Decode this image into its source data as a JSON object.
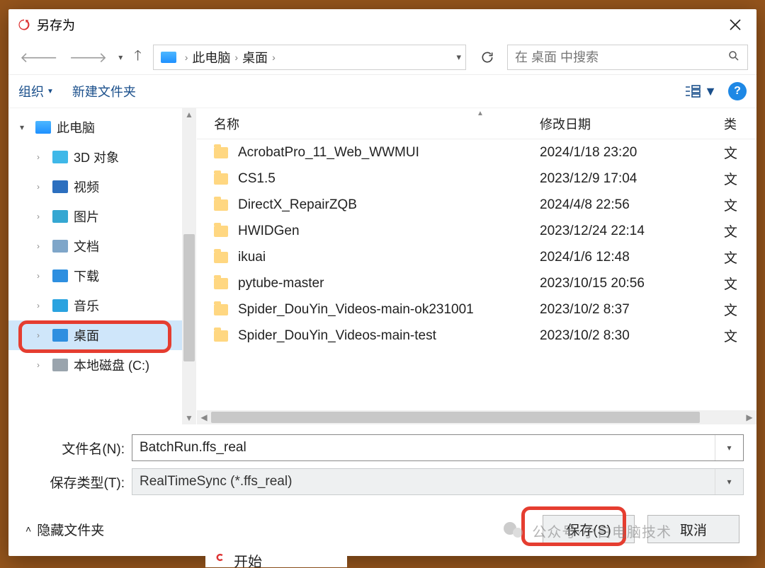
{
  "title": "另存为",
  "breadcrumb": {
    "root": "此电脑",
    "folder": "桌面"
  },
  "search_placeholder": "在 桌面 中搜索",
  "cmdbar": {
    "organize": "组织",
    "newfolder": "新建文件夹"
  },
  "columns": {
    "name": "名称",
    "date": "修改日期",
    "type": "类"
  },
  "tree": {
    "thispc": "此电脑",
    "items": [
      {
        "label": "3D 对象",
        "icon_color": "#3fb8e8"
      },
      {
        "label": "视频",
        "icon_color": "#2c6fbf"
      },
      {
        "label": "图片",
        "icon_color": "#35a7d2"
      },
      {
        "label": "文档",
        "icon_color": "#7fa6c9"
      },
      {
        "label": "下载",
        "icon_color": "#2e8fe0"
      },
      {
        "label": "音乐",
        "icon_color": "#2aa3e0"
      },
      {
        "label": "桌面",
        "icon_color": "#2e8fe0",
        "selected": true
      },
      {
        "label": "本地磁盘 (C:)",
        "icon_color": "#9aa4ad"
      }
    ]
  },
  "files": [
    {
      "name": "AcrobatPro_11_Web_WWMUI",
      "date": "2024/1/18 23:20",
      "type": "文"
    },
    {
      "name": "CS1.5",
      "date": "2023/12/9 17:04",
      "type": "文"
    },
    {
      "name": "DirectX_RepairZQB",
      "date": "2024/4/8 22:56",
      "type": "文"
    },
    {
      "name": "HWIDGen",
      "date": "2023/12/24 22:14",
      "type": "文"
    },
    {
      "name": "ikuai",
      "date": "2024/1/6 12:48",
      "type": "文"
    },
    {
      "name": "pytube-master",
      "date": "2023/10/15 20:56",
      "type": "文"
    },
    {
      "name": "Spider_DouYin_Videos-main-ok231001",
      "date": "2023/10/2 8:37",
      "type": "文"
    },
    {
      "name": "Spider_DouYin_Videos-main-test",
      "date": "2023/10/2 8:30",
      "type": "文"
    }
  ],
  "saveas": {
    "filename_label": "文件名(N):",
    "filetype_label": "保存类型(T):",
    "filename_value": "BatchRun.ffs_real",
    "filetype_value": "RealTimeSync (*.ffs_real)"
  },
  "footer": {
    "hide_folders": "隐藏文件夹",
    "save": "保存(S)",
    "cancel": "取消"
  },
  "watermark": "公众号·小白电脑技术",
  "below": "开始"
}
